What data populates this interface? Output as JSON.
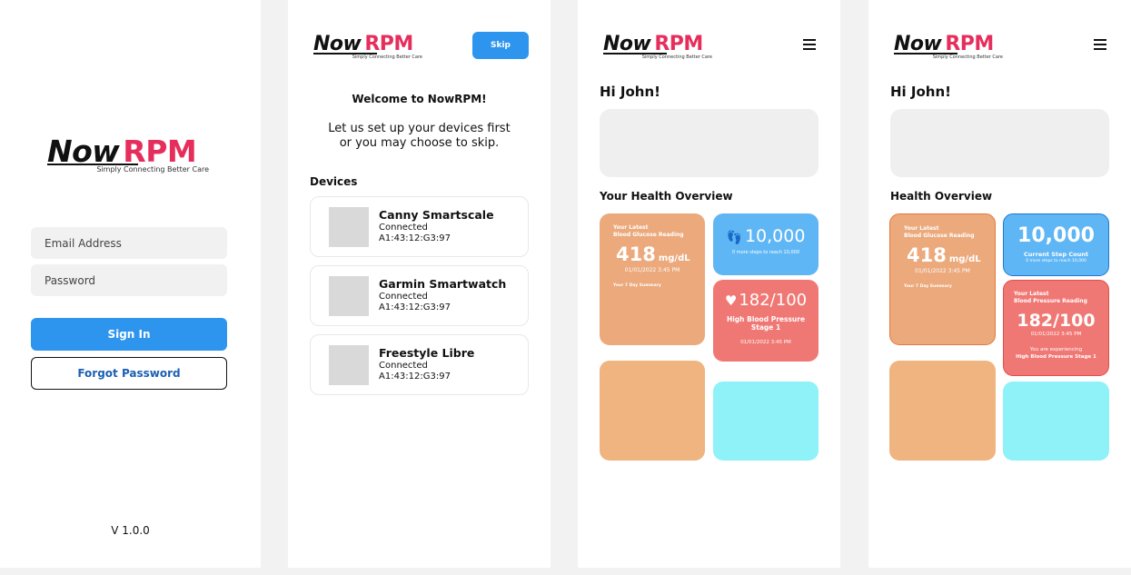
{
  "brand": {
    "now": "Now",
    "rpm": "RPM",
    "tagline": "Simply Connecting Better Care"
  },
  "login": {
    "email_placeholder": "Email Address",
    "password_placeholder": "Password",
    "sign_in": "Sign In",
    "forgot_password": "Forgot Password",
    "version": "V 1.0.0"
  },
  "onboarding": {
    "skip": "Skip",
    "welcome": "Welcome to NowRPM!",
    "intro_line1": "Let us set up your devices first",
    "intro_line2": "or you may choose to skip.",
    "devices_title": "Devices",
    "devices": [
      {
        "name": "Canny Smartscale",
        "status": "Connected",
        "mac": "A1:43:12:G3:97"
      },
      {
        "name": "Garmin Smartwatch",
        "status": "Connected",
        "mac": "A1:43:12:G3:97"
      },
      {
        "name": "Freestyle Libre",
        "status": "Connected",
        "mac": "A1:43:12:G3:97"
      }
    ]
  },
  "dashboard_a": {
    "greeting": "Hi John!",
    "section_title": "Your Health Overview",
    "glucose": {
      "label_line1": "Your Latest",
      "label_line2": "Blood Glucose Reading",
      "value": "418",
      "unit": "mg/dL",
      "datetime": "01/01/2022 3:45 PM",
      "summary": "Your 7 Day Summary"
    },
    "steps": {
      "value": "10,000",
      "subtext": "0 more steps to reach 10,000",
      "icon": "footprints-icon"
    },
    "bp": {
      "value": "182/100",
      "stage_line1": "High Blood Pressure",
      "stage_line2": "Stage 1",
      "datetime": "01/01/2022 3:45 PM",
      "icon": "heart-icon"
    }
  },
  "dashboard_b": {
    "greeting": "Hi John!",
    "section_title": "Health Overview",
    "glucose": {
      "label_line1": "Your Latest",
      "label_line2": "Blood Glucose Reading",
      "value": "418",
      "unit": "mg/dL",
      "datetime": "01/01/2022 3:45 PM",
      "summary": "Your 7 Day Summary"
    },
    "steps": {
      "value": "10,000",
      "label": "Current Step Count",
      "subtext": "0 more steps to reach 10,000"
    },
    "bp": {
      "label_line1": "Your Latest",
      "label_line2": "Blood Pressure Reading",
      "value": "182/100",
      "datetime": "01/01/2022 3:45 PM",
      "message": "You are experiencing",
      "stage": "High Blood Pressure Stage 1"
    }
  },
  "colors": {
    "primary": "#2e95ef",
    "brand_red": "#e62e5c",
    "glucose_card": "#eba97c",
    "steps_card": "#5fb6f5",
    "bp_card": "#f07874",
    "cyan_card": "#8ef2f8"
  }
}
